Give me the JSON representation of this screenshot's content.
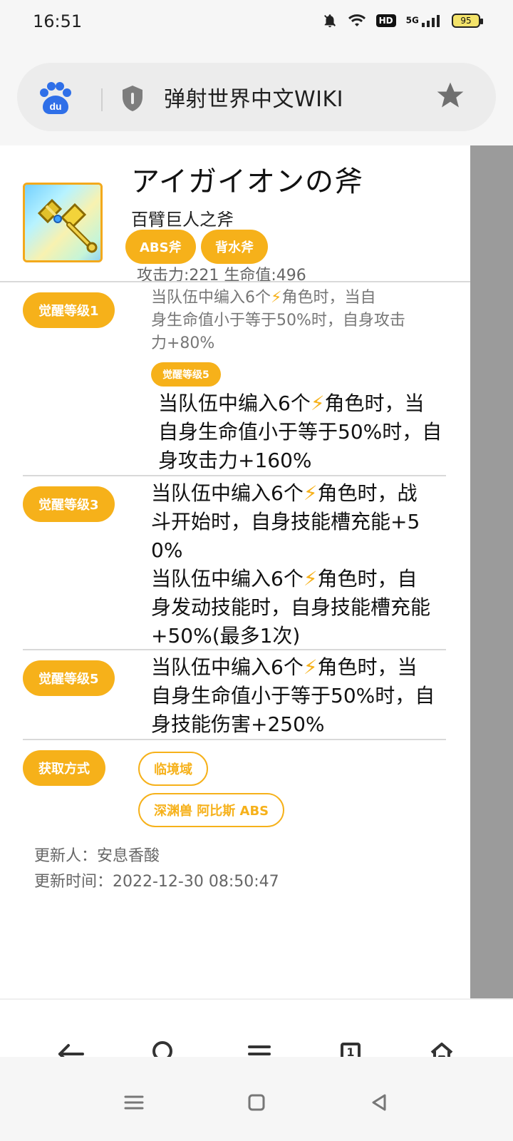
{
  "status_bar": {
    "time": "16:51",
    "icons": [
      "bell-off-icon",
      "wifi-icon",
      "hd-icon",
      "signal-5g-icon",
      "battery-icon"
    ],
    "hd_label": "HD",
    "network_label": "5G",
    "battery_percent": "95"
  },
  "browser": {
    "site_title": "弹射世界中文WIKI",
    "logo_text": "du",
    "icons": {
      "logo": "baidu-logo-icon",
      "shield": "shield-icon",
      "bookmark": "star-icon"
    }
  },
  "item": {
    "title": "アイガイオンの斧",
    "subtitle": "百臂巨人之斧",
    "tags": [
      "ABS斧",
      "背水斧"
    ],
    "stats": "攻击力:221 生命值:496",
    "icon": "axe-icon"
  },
  "rows": [
    {
      "badge": "觉醒等级1",
      "text_small_lines": [
        "当队伍中编入6个",
        "⚡",
        "角色时，当自",
        "身生命值小于等于50%时，自身攻击",
        "力+80%"
      ],
      "sub_badge": "觉醒等级5",
      "text_lines": [
        "当队伍中编入6个",
        "⚡",
        "角色时，当",
        "自身生命值小于等于50%时，自",
        "身攻击力+160%"
      ]
    },
    {
      "badge": "觉醒等级3",
      "text_lines": [
        "当队伍中编入6个",
        "⚡",
        "角色时，战",
        "斗开始时，自身技能槽充能+5",
        "0%"
      ],
      "text2_lines": [
        "当队伍中编入6个",
        "⚡",
        "角色时，自",
        "身发动技能时，自身技能槽充能",
        "+50%(最多1次)"
      ]
    },
    {
      "badge": "觉醒等级5",
      "text_lines": [
        "当队伍中编入6个",
        "⚡",
        "角色时，当",
        "自身生命值小于等于50%时，自",
        "身技能伤害+250%"
      ]
    }
  ],
  "acquisition": {
    "badge": "获取方式",
    "sources": [
      "临境域",
      "深渊兽 阿比斯 ABS"
    ]
  },
  "footer_meta": {
    "updater": "更新人：安息香酸",
    "update_time": "更新时间：2022-12-30 08:50:47"
  },
  "bottom_nav": {
    "items": [
      "back-arrow-icon",
      "search-icon",
      "menu-icon",
      "tabs-icon",
      "home-icon"
    ],
    "tabs_count": "1"
  },
  "system_nav": {
    "items": [
      "recent-apps-icon",
      "home-square-icon",
      "back-triangle-icon"
    ]
  },
  "colors": {
    "accent": "#f6b11a",
    "muted_text": "#777777",
    "panel_bg": "#f6f6f6",
    "side_gray": "#9b9b9b"
  }
}
